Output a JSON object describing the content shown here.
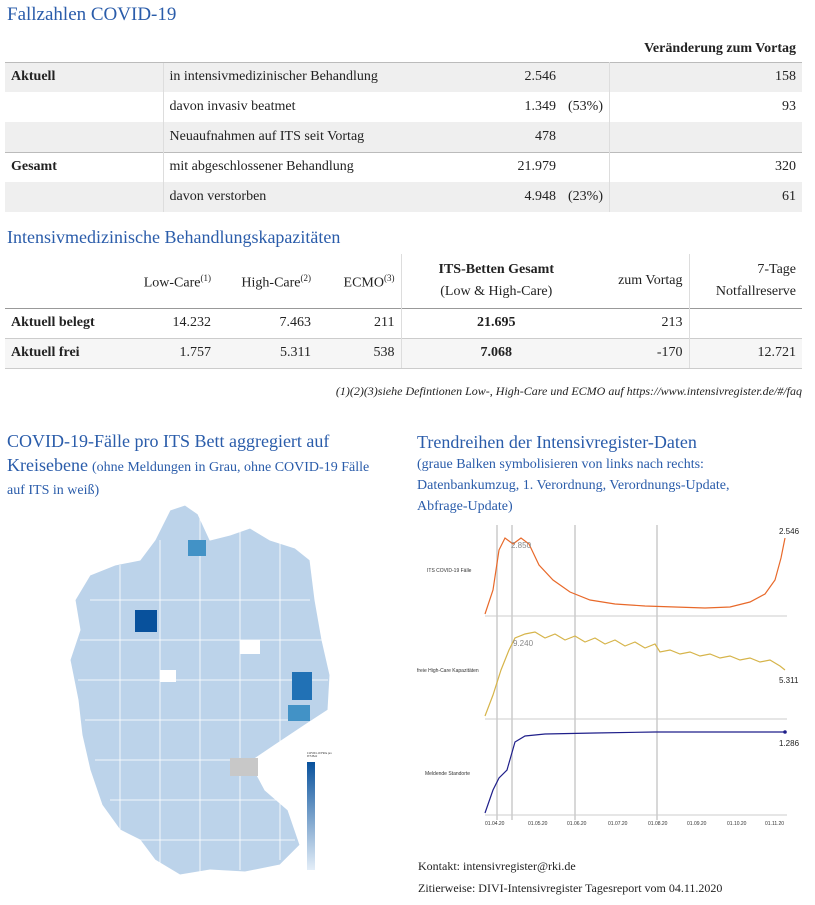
{
  "section1": {
    "title": "Fallzahlen COVID-19",
    "change_header": "Veränderung zum Vortag",
    "rows": [
      {
        "group": "Aktuell",
        "desc": "in intensivmedizinischer Behandlung",
        "value": "2.546",
        "pct": "",
        "change": "158"
      },
      {
        "group": "",
        "desc": "davon invasiv beatmet",
        "value": "1.349",
        "pct": "(53%)",
        "change": "93"
      },
      {
        "group": "",
        "desc": "Neuaufnahmen auf ITS seit Vortag",
        "value": "478",
        "pct": "",
        "change": ""
      },
      {
        "group": "Gesamt",
        "desc": "mit abgeschlossener Behandlung",
        "value": "21.979",
        "pct": "",
        "change": "320"
      },
      {
        "group": "",
        "desc": "davon verstorben",
        "value": "4.948",
        "pct": "(23%)",
        "change": "61"
      }
    ]
  },
  "section2": {
    "title": "Intensivmedizinische Behandlungskapazitäten",
    "headers": {
      "low_care": "Low-Care",
      "low_care_sup": "(1)",
      "high_care": "High-Care",
      "high_care_sup": "(2)",
      "ecmo": "ECMO",
      "ecmo_sup": "(3)",
      "its_total": "ITS-Betten Gesamt",
      "its_total_sub": "(Low & High-Care)",
      "prev_day": "zum Vortag",
      "reserve_line1": "7-Tage",
      "reserve_line2": "Notfallreserve"
    },
    "rows": [
      {
        "label": "Aktuell belegt",
        "low": "14.232",
        "high": "7.463",
        "ecmo": "211",
        "total": "21.695",
        "prev": "213",
        "reserve": ""
      },
      {
        "label": "Aktuell frei",
        "low": "1.757",
        "high": "5.311",
        "ecmo": "538",
        "total": "7.068",
        "prev": "-170",
        "reserve": "12.721"
      }
    ],
    "footnote": "(1)(2)(3)siehe Defintionen Low-, High-Care und ECMO auf https://www.intensivregister.de/#/faq"
  },
  "map": {
    "title": "COVID-19-Fälle pro ITS Bett aggregiert auf Kreisebene",
    "subtitle": "(ohne Meldungen in Grau, ohne COVID-19 Fälle auf ITS in weiß)",
    "legend_title": "COVID-19 Fälle pro ITS Bett",
    "legend_color_low": "#e4eef8",
    "legend_color_high": "#08519c"
  },
  "trend": {
    "title": "Trendreihen der Intensivregister-Daten",
    "subtitle": "(graue Balken symbolisieren von links nach rechts: Datenbankumzug, 1. Verordnung, Verordnungs-Update, Abfrage-Update)",
    "x_ticks": [
      "01.04.20",
      "01.05.20",
      "01.06.20",
      "01.07.20",
      "01.08.20",
      "01.09.20",
      "01.10.20",
      "01.11.20"
    ]
  },
  "chart_data": [
    {
      "type": "line",
      "series": [
        {
          "name": "ITS COVID-19 Fälle",
          "color": "#e8692a"
        }
      ],
      "annotations": [
        "2.850",
        "2.546"
      ]
    },
    {
      "type": "line",
      "series": [
        {
          "name": "freie High-Care Kapazitäten",
          "color": "#d6b44a"
        }
      ],
      "annotations": [
        "9.240",
        "5.311"
      ]
    },
    {
      "type": "line",
      "series": [
        {
          "name": "Meldende Standorte",
          "color": "#1f1f8a"
        }
      ],
      "annotations": [
        "1.286"
      ]
    }
  ],
  "contact": {
    "line1": "Kontakt: intensivregister@rki.de",
    "line2": "Zitierweise: DIVI-Intensivregister Tagesreport vom 04.11.2020"
  }
}
